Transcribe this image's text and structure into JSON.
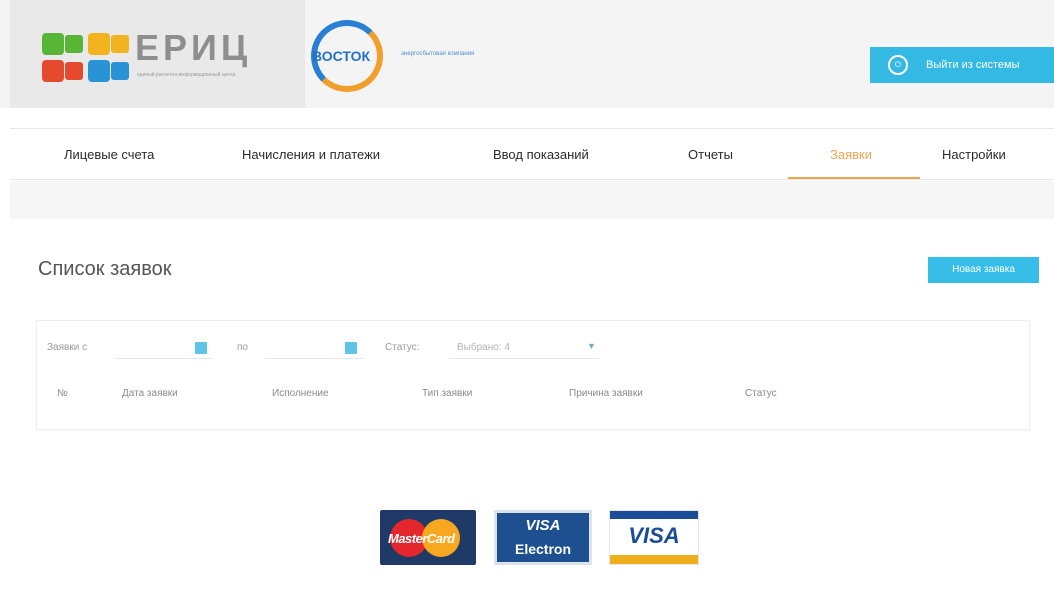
{
  "header": {
    "logo_title": "ЕРИЦ",
    "logo_subtitle": "единый расчетно-информационный центр",
    "partner_logo": "ВОСТОК",
    "partner_subtitle": "энергосбытовая компания",
    "exit_button_label": "Выйти из системы",
    "exit_icon": "exit-icon"
  },
  "nav": {
    "items": [
      {
        "label": "Лицевые счета"
      },
      {
        "label": "Начисления и платежи"
      },
      {
        "label": "Ввод показаний"
      },
      {
        "label": "Отчеты"
      },
      {
        "label": "Заявки"
      },
      {
        "label": "Настройки"
      }
    ],
    "active_index": 4
  },
  "main": {
    "title": "Список заявок",
    "new_button_label": "Новая заявка"
  },
  "filters": {
    "from_label": "Заявки с",
    "to_label": "по",
    "status_label": "Статус:",
    "status_value": "Выбрано: 4"
  },
  "table": {
    "columns": [
      "№",
      "Дата заявки",
      "Исполнение",
      "Тип заявки",
      "Причина заявки",
      "Статус"
    ]
  },
  "payments": {
    "mastercard": "MasterCard",
    "visa_electron_top": "VISA",
    "visa_electron_bottom": "Electron",
    "visa": "VISA"
  },
  "colors": {
    "accent": "#36bde8",
    "active_tab": "#f0a650"
  }
}
